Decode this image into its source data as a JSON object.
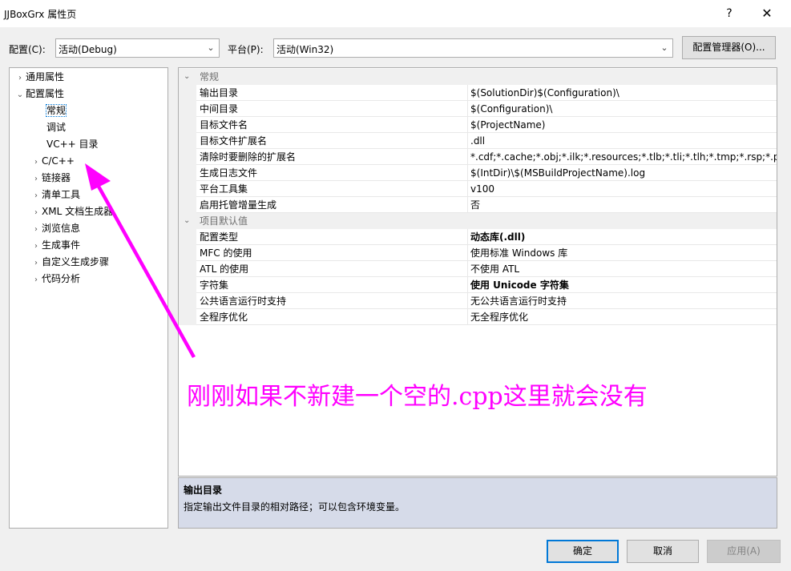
{
  "window": {
    "title": "JJBoxGrx 属性页",
    "help_label": "?",
    "close_label": "✕"
  },
  "toolbar": {
    "config_label": "配置(C):",
    "config_value": "活动(Debug)",
    "platform_label": "平台(P):",
    "platform_value": "活动(Win32)",
    "config_manager_label": "配置管理器(O)..."
  },
  "tree": {
    "items": [
      {
        "label": "通用属性",
        "expander": "›"
      },
      {
        "label": "配置属性",
        "expander": "⌄"
      },
      {
        "label": "常规",
        "expander": ""
      },
      {
        "label": "调试",
        "expander": ""
      },
      {
        "label": "VC++ 目录",
        "expander": ""
      },
      {
        "label": "C/C++",
        "expander": "›"
      },
      {
        "label": "链接器",
        "expander": "›"
      },
      {
        "label": "清单工具",
        "expander": "›"
      },
      {
        "label": "XML 文档生成器",
        "expander": "›"
      },
      {
        "label": "浏览信息",
        "expander": "›"
      },
      {
        "label": "生成事件",
        "expander": "›"
      },
      {
        "label": "自定义生成步骤",
        "expander": "›"
      },
      {
        "label": "代码分析",
        "expander": "›"
      }
    ],
    "selected": "常规"
  },
  "grid": {
    "categories": [
      {
        "name": "常规",
        "rows": [
          {
            "name": "输出目录",
            "value": "$(SolutionDir)$(Configuration)\\"
          },
          {
            "name": "中间目录",
            "value": "$(Configuration)\\"
          },
          {
            "name": "目标文件名",
            "value": "$(ProjectName)"
          },
          {
            "name": "目标文件扩展名",
            "value": ".dll"
          },
          {
            "name": "清除时要删除的扩展名",
            "value": "*.cdf;*.cache;*.obj;*.ilk;*.resources;*.tlb;*.tli;*.tlh;*.tmp;*.rsp;*.pgc"
          },
          {
            "name": "生成日志文件",
            "value": "$(IntDir)\\$(MSBuildProjectName).log"
          },
          {
            "name": "平台工具集",
            "value": "v100"
          },
          {
            "name": "启用托管增量生成",
            "value": "否"
          }
        ]
      },
      {
        "name": "项目默认值",
        "rows": [
          {
            "name": "配置类型",
            "value": "动态库(.dll)"
          },
          {
            "name": "MFC 的使用",
            "value": "使用标准 Windows 库"
          },
          {
            "name": "ATL 的使用",
            "value": "不使用 ATL"
          },
          {
            "name": "字符集",
            "value": "使用 Unicode 字符集"
          },
          {
            "name": "公共语言运行时支持",
            "value": "无公共语言运行时支持"
          },
          {
            "name": "全程序优化",
            "value": "无全程序优化"
          }
        ]
      }
    ]
  },
  "description": {
    "title": "输出目录",
    "text": "指定输出文件目录的相对路径；可以包含环境变量。"
  },
  "annotation": {
    "text": "刚刚如果不新建一个空的.cpp这里就会没有",
    "color": "#ff00ff"
  },
  "buttons": {
    "ok": "确定",
    "cancel": "取消",
    "apply": "应用(A)"
  },
  "colors": {
    "selection": "#0078d7",
    "desc_bg": "#d6dbe9"
  }
}
